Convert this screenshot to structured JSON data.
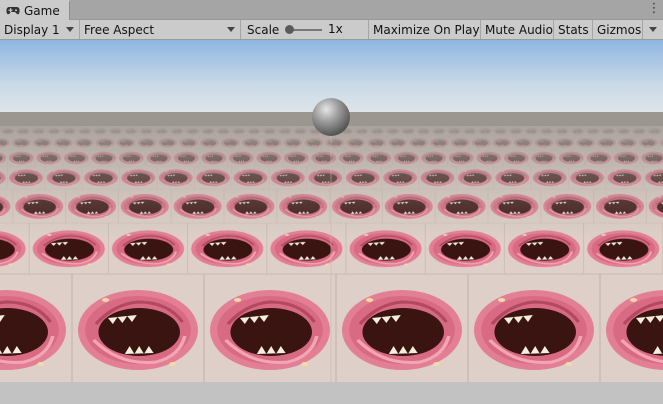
{
  "window": {
    "tab_title": "Game",
    "tab_icon": "gamepad-icon",
    "menu_icon": "kebab-menu-icon"
  },
  "toolbar": {
    "display": "Display 1",
    "aspect": "Free Aspect",
    "scale_label": "Scale",
    "scale_value": "1x",
    "maximize_on_play": "Maximize On Play",
    "mute_audio": "Mute Audio",
    "stats": "Stats",
    "gizmos": "Gizmos"
  },
  "scene": {
    "sky_top": "#8fb6e0",
    "horizon": "#dfe5ea",
    "ground_far": "#9a958f",
    "tile_bg": "#e0cfc6",
    "lip_color": "#e8879b",
    "mouth_color": "#3a1410",
    "teeth_color": "#f4eedd",
    "sphere_color": "#8a8a8a"
  }
}
